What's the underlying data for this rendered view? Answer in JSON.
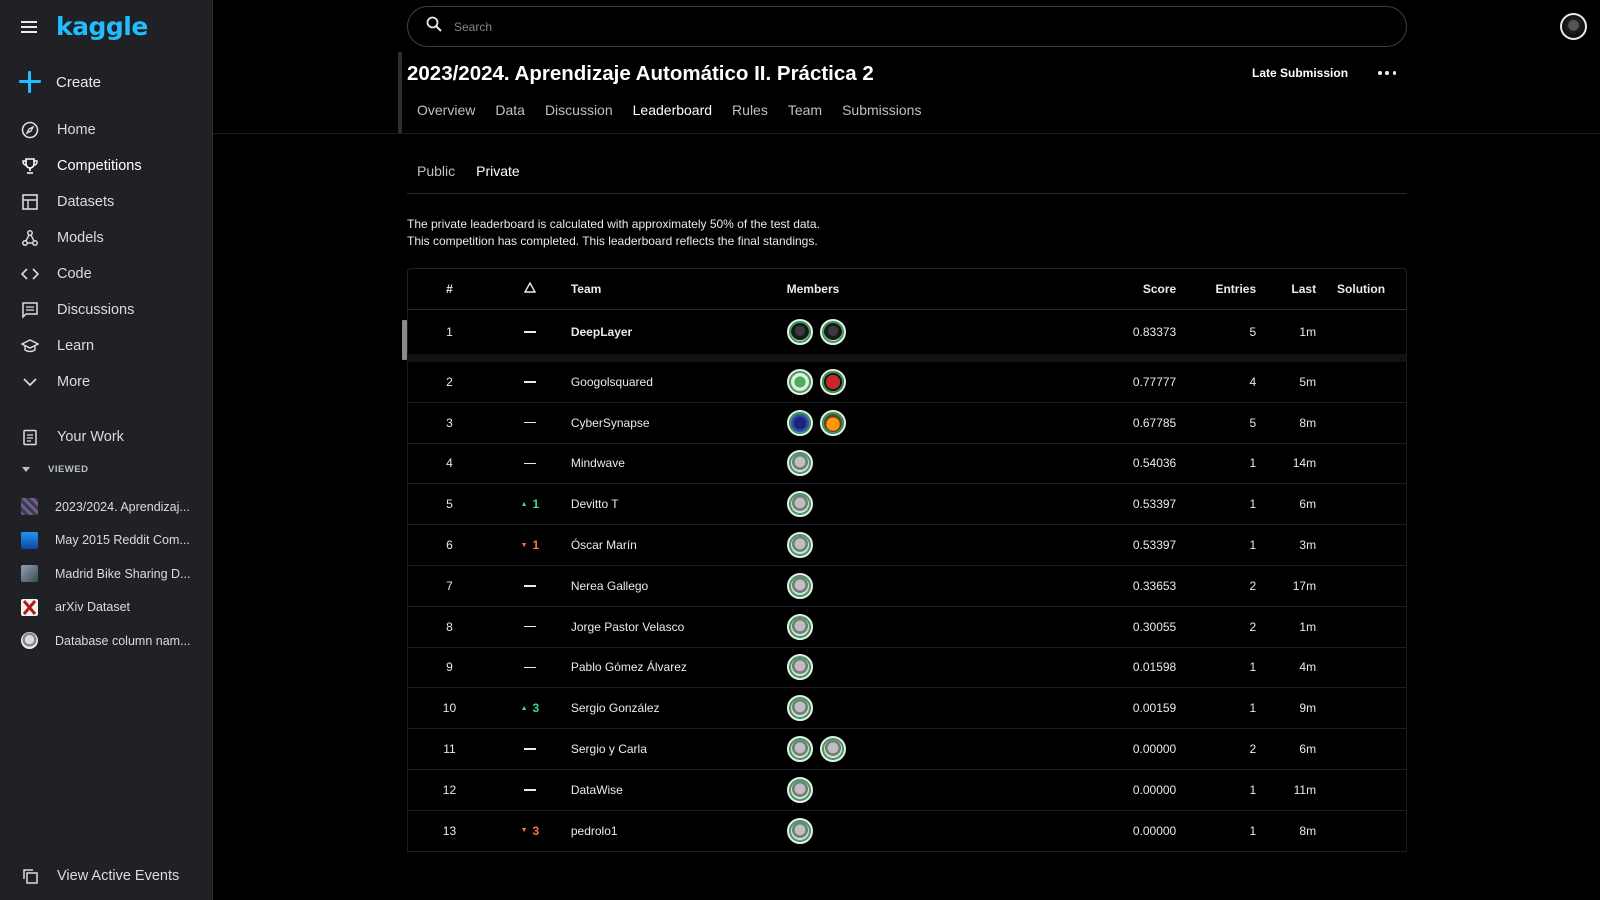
{
  "app": {
    "logo": "kaggle"
  },
  "sidebar": {
    "create_label": "Create",
    "items": [
      {
        "label": "Home",
        "icon": "compass-icon"
      },
      {
        "label": "Competitions",
        "icon": "trophy-icon",
        "active": true
      },
      {
        "label": "Datasets",
        "icon": "table-icon"
      },
      {
        "label": "Models",
        "icon": "models-icon"
      },
      {
        "label": "Code",
        "icon": "code-icon"
      },
      {
        "label": "Discussions",
        "icon": "discussion-icon"
      },
      {
        "label": "Learn",
        "icon": "school-icon"
      },
      {
        "label": "More",
        "icon": "chevron-down-icon"
      }
    ],
    "your_work": "Your Work",
    "viewed_heading": "VIEWED",
    "viewed": [
      {
        "label": "2023/2024. Aprendizaj...",
        "color": "#5b4f73"
      },
      {
        "label": "May 2015 Reddit Com...",
        "color": "#1e88e5"
      },
      {
        "label": "Madrid Bike Sharing D...",
        "color": "#5e6e7a"
      },
      {
        "label": "arXiv Dataset",
        "color": "#b71c1c"
      },
      {
        "label": "Database column nam...",
        "color": "#9e9e9e"
      }
    ],
    "view_events": "View Active Events"
  },
  "search": {
    "placeholder": "Search"
  },
  "competition": {
    "title": "2023/2024. Aprendizaje Automático II. Práctica 2",
    "late_submission": "Late Submission",
    "tabs": [
      "Overview",
      "Data",
      "Discussion",
      "Leaderboard",
      "Rules",
      "Team",
      "Submissions"
    ],
    "active_tab": "Leaderboard"
  },
  "leaderboard": {
    "subtabs": [
      "Public",
      "Private"
    ],
    "active_subtab": "Private",
    "info_line1": "The private leaderboard is calculated with approximately 50% of the test data.",
    "info_line2": "This competition has completed. This leaderboard reflects the final standings.",
    "columns": {
      "rank": "#",
      "team": "Team",
      "members": "Members",
      "score": "Score",
      "entries": "Entries",
      "last": "Last",
      "solution": "Solution"
    },
    "rows": [
      {
        "rank": "1",
        "delta": "",
        "dir": "none",
        "team": "DeepLayer",
        "members": 2,
        "score": "0.83373",
        "entries": "5",
        "last": "1m"
      },
      {
        "rank": "2",
        "delta": "",
        "dir": "none",
        "team": "Googolsquared",
        "members": 2,
        "score": "0.77777",
        "entries": "4",
        "last": "5m"
      },
      {
        "rank": "3",
        "delta": "",
        "dir": "none",
        "team": "CyberSynapse",
        "members": 2,
        "score": "0.67785",
        "entries": "5",
        "last": "8m"
      },
      {
        "rank": "4",
        "delta": "",
        "dir": "none",
        "team": "Mindwave",
        "members": 1,
        "score": "0.54036",
        "entries": "1",
        "last": "14m"
      },
      {
        "rank": "5",
        "delta": "1",
        "dir": "up",
        "team": "Devitto T",
        "members": 1,
        "score": "0.53397",
        "entries": "1",
        "last": "6m"
      },
      {
        "rank": "6",
        "delta": "1",
        "dir": "down",
        "team": "Óscar Marín",
        "members": 1,
        "score": "0.53397",
        "entries": "1",
        "last": "3m"
      },
      {
        "rank": "7",
        "delta": "",
        "dir": "none",
        "team": "Nerea Gallego",
        "members": 1,
        "score": "0.33653",
        "entries": "2",
        "last": "17m"
      },
      {
        "rank": "8",
        "delta": "",
        "dir": "none",
        "team": "Jorge Pastor Velasco",
        "members": 1,
        "score": "0.30055",
        "entries": "2",
        "last": "1m"
      },
      {
        "rank": "9",
        "delta": "",
        "dir": "none",
        "team": "Pablo Gómez Álvarez",
        "members": 1,
        "score": "0.01598",
        "entries": "1",
        "last": "4m"
      },
      {
        "rank": "10",
        "delta": "3",
        "dir": "up",
        "team": "Sergio González",
        "members": 1,
        "score": "0.00159",
        "entries": "1",
        "last": "9m"
      },
      {
        "rank": "11",
        "delta": "",
        "dir": "none",
        "team": "Sergio y Carla",
        "members": 2,
        "score": "0.00000",
        "entries": "2",
        "last": "6m"
      },
      {
        "rank": "12",
        "delta": "",
        "dir": "none",
        "team": "DataWise",
        "members": 1,
        "score": "0.00000",
        "entries": "1",
        "last": "11m"
      },
      {
        "rank": "13",
        "delta": "3",
        "dir": "down",
        "team": "pedrolo1",
        "members": 1,
        "score": "0.00000",
        "entries": "1",
        "last": "8m"
      }
    ]
  },
  "colors": {
    "accent": "#20beff",
    "up": "#3cdc8c",
    "down": "#ff7043"
  }
}
